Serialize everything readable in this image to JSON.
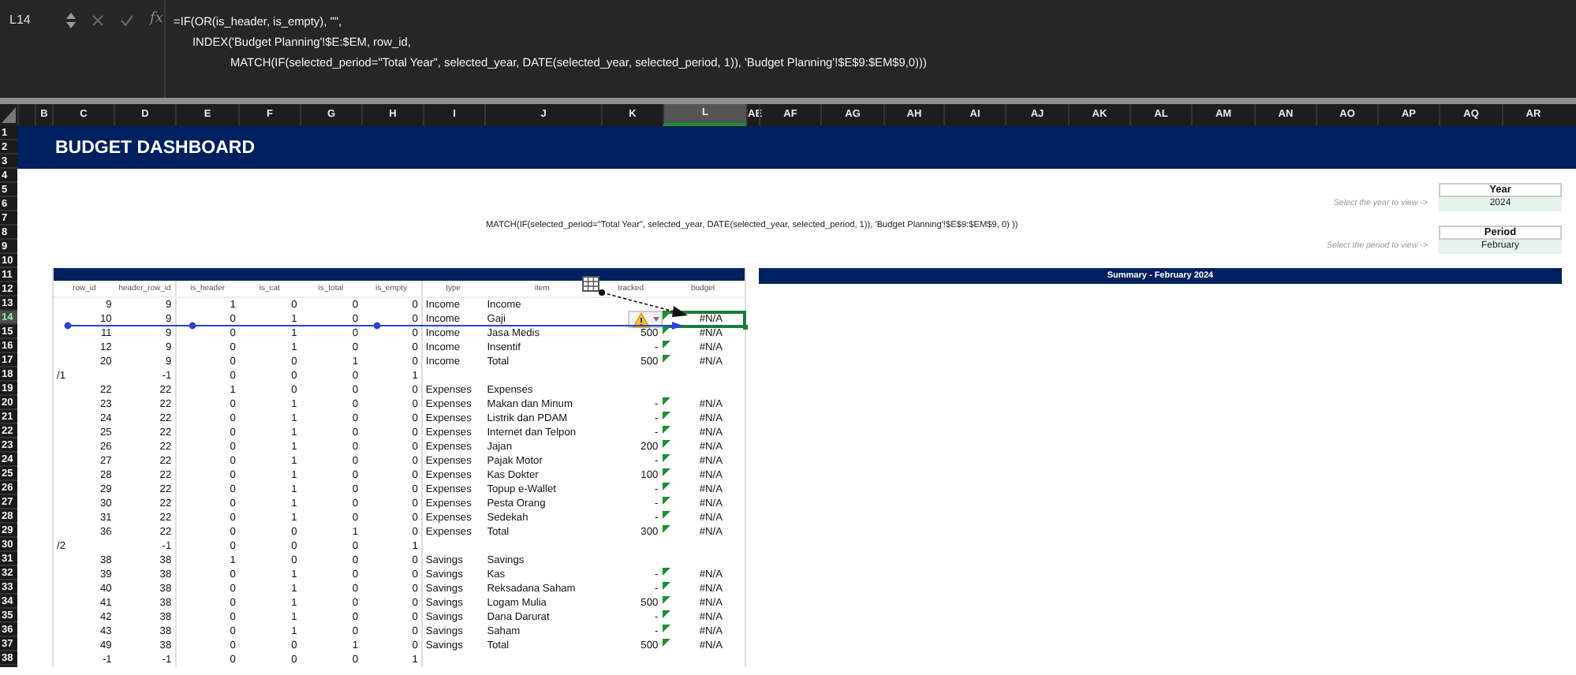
{
  "formula_bar": {
    "cell_ref": "L14",
    "function_label": "fx",
    "lines": [
      {
        "kind": "start",
        "text": "=IF(OR(is_header, is_empty), \"\","
      },
      {
        "kind": "indent",
        "text": "INDEX('Budget Planning'!$E:$EM, row_id,"
      },
      {
        "kind": "deep",
        "text": "MATCH(IF(selected_period=\"Total Year\", selected_year, DATE(selected_year, selected_period, 1)), 'Budget Planning'!$E$9:$EM$9,0)))"
      }
    ]
  },
  "columns": [
    {
      "label": "B",
      "selected": false
    },
    {
      "label": "C",
      "selected": false
    },
    {
      "label": "D",
      "selected": false
    },
    {
      "label": "E",
      "selected": false
    },
    {
      "label": "F",
      "selected": false
    },
    {
      "label": "G",
      "selected": false
    },
    {
      "label": "H",
      "selected": false
    },
    {
      "label": "I",
      "selected": false
    },
    {
      "label": "J",
      "selected": false
    },
    {
      "label": "K",
      "selected": false
    },
    {
      "label": "L",
      "selected": true
    },
    {
      "label": "AE",
      "selected": false
    },
    {
      "label": "AF",
      "selected": false
    },
    {
      "label": "AG",
      "selected": false
    },
    {
      "label": "AH",
      "selected": false
    },
    {
      "label": "AI",
      "selected": false
    },
    {
      "label": "AJ",
      "selected": false
    },
    {
      "label": "AK",
      "selected": false
    },
    {
      "label": "AL",
      "selected": false
    },
    {
      "label": "AM",
      "selected": false
    },
    {
      "label": "AN",
      "selected": false
    },
    {
      "label": "AO",
      "selected": false
    },
    {
      "label": "AP",
      "selected": false
    },
    {
      "label": "AQ",
      "selected": false
    },
    {
      "label": "AR",
      "selected": false
    }
  ],
  "row_numbers": [
    {
      "label": "1",
      "selected": false
    },
    {
      "label": "2",
      "selected": false
    },
    {
      "label": "3",
      "selected": false
    },
    {
      "label": "4",
      "selected": false
    },
    {
      "label": "5",
      "selected": false
    },
    {
      "label": "6",
      "selected": false
    },
    {
      "label": "7",
      "selected": false
    },
    {
      "label": "8",
      "selected": false
    },
    {
      "label": "9",
      "selected": false
    },
    {
      "label": "10",
      "selected": false
    },
    {
      "label": "11",
      "selected": false
    },
    {
      "label": "12",
      "selected": false
    },
    {
      "label": "13",
      "selected": false
    },
    {
      "label": "14",
      "selected": true
    },
    {
      "label": "15",
      "selected": false
    },
    {
      "label": "16",
      "selected": false
    },
    {
      "label": "17",
      "selected": false
    },
    {
      "label": "18",
      "selected": false
    },
    {
      "label": "19",
      "selected": false
    },
    {
      "label": "20",
      "selected": false
    },
    {
      "label": "21",
      "selected": false
    },
    {
      "label": "22",
      "selected": false
    },
    {
      "label": "23",
      "selected": false
    },
    {
      "label": "24",
      "selected": false
    },
    {
      "label": "25",
      "selected": false
    },
    {
      "label": "26",
      "selected": false
    },
    {
      "label": "27",
      "selected": false
    },
    {
      "label": "28",
      "selected": false
    },
    {
      "label": "29",
      "selected": false
    },
    {
      "label": "30",
      "selected": false
    },
    {
      "label": "31",
      "selected": false
    },
    {
      "label": "32",
      "selected": false
    },
    {
      "label": "33",
      "selected": false
    },
    {
      "label": "34",
      "selected": false
    },
    {
      "label": "35",
      "selected": false
    },
    {
      "label": "36",
      "selected": false
    },
    {
      "label": "37",
      "selected": false
    },
    {
      "label": "38",
      "selected": false
    }
  ],
  "title": "BUDGET DASHBOARD",
  "formula_note": "MATCH(IF(selected_period=\"Total Year\", selected_year, DATE(selected_year, selected_period, 1)), 'Budget Planning'!$E$9:$EM$9, 0) ))",
  "year": {
    "label": "Year",
    "hint": "Select the year to view ->",
    "value": "2024"
  },
  "period": {
    "label": "Period",
    "hint": "Select the period to view ->",
    "value": "February"
  },
  "summary_title": "Summary - February 2024",
  "table": {
    "columns": [
      "row_id",
      "header_row_id",
      "is_header",
      "is_cat",
      "is_total",
      "is_empty",
      "type",
      "item",
      "tracked",
      "budget"
    ],
    "rows": [
      {
        "kind": "data",
        "row_id": "9",
        "header_row_id": "9",
        "is_header": "1",
        "is_cat": "0",
        "is_total": "0",
        "is_empty": "0",
        "type": "Income",
        "item": "Income",
        "flagged": false,
        "traced": false,
        "selected": false
      },
      {
        "kind": "data",
        "row_id": "10",
        "header_row_id": "9",
        "is_header": "0",
        "is_cat": "1",
        "is_total": "0",
        "is_empty": "0",
        "type": "Income",
        "item": "Gaji",
        "budget": "#N/A",
        "flagged": true,
        "traced": true,
        "selected": true
      },
      {
        "kind": "data",
        "row_id": "11",
        "header_row_id": "9",
        "is_header": "0",
        "is_cat": "1",
        "is_total": "0",
        "is_empty": "0",
        "type": "Income",
        "item": "Jasa Medis",
        "tracked": "500",
        "budget": "#N/A",
        "flagged": true,
        "traced": false,
        "selected": false
      },
      {
        "kind": "data",
        "row_id": "12",
        "header_row_id": "9",
        "is_header": "0",
        "is_cat": "1",
        "is_total": "0",
        "is_empty": "0",
        "type": "Income",
        "item": "Insentif",
        "tracked": "-",
        "budget": "#N/A",
        "flagged": true,
        "traced": false,
        "selected": false
      },
      {
        "kind": "data",
        "row_id": "20",
        "header_row_id": "9",
        "is_header": "0",
        "is_cat": "0",
        "is_total": "1",
        "is_empty": "0",
        "type": "Income",
        "item": "Total",
        "tracked": "500",
        "budget": "#N/A",
        "flagged": true,
        "traced": false,
        "selected": false
      },
      {
        "kind": "separator",
        "row_id": "/1",
        "header_row_id": "-1",
        "is_header": "0",
        "is_cat": "0",
        "is_total": "0",
        "is_empty": "1",
        "flagged": false,
        "traced": false,
        "selected": false
      },
      {
        "kind": "data",
        "row_id": "22",
        "header_row_id": "22",
        "is_header": "1",
        "is_cat": "0",
        "is_total": "0",
        "is_empty": "0",
        "type": "Expenses",
        "item": "Expenses",
        "flagged": false,
        "traced": false,
        "selected": false
      },
      {
        "kind": "data",
        "row_id": "23",
        "header_row_id": "22",
        "is_header": "0",
        "is_cat": "1",
        "is_total": "0",
        "is_empty": "0",
        "type": "Expenses",
        "item": "Makan dan Minum",
        "tracked": "-",
        "budget": "#N/A",
        "flagged": true,
        "traced": false,
        "selected": false
      },
      {
        "kind": "data",
        "row_id": "24",
        "header_row_id": "22",
        "is_header": "0",
        "is_cat": "1",
        "is_total": "0",
        "is_empty": "0",
        "type": "Expenses",
        "item": "Listrik dan PDAM",
        "tracked": "-",
        "budget": "#N/A",
        "flagged": true,
        "traced": false,
        "selected": false
      },
      {
        "kind": "data",
        "row_id": "25",
        "header_row_id": "22",
        "is_header": "0",
        "is_cat": "1",
        "is_total": "0",
        "is_empty": "0",
        "type": "Expenses",
        "item": "Internet dan Telpon",
        "tracked": "-",
        "budget": "#N/A",
        "flagged": true,
        "traced": false,
        "selected": false
      },
      {
        "kind": "data",
        "row_id": "26",
        "header_row_id": "22",
        "is_header": "0",
        "is_cat": "1",
        "is_total": "0",
        "is_empty": "0",
        "type": "Expenses",
        "item": "Jajan",
        "tracked": "200",
        "budget": "#N/A",
        "flagged": true,
        "traced": false,
        "selected": false
      },
      {
        "kind": "data",
        "row_id": "27",
        "header_row_id": "22",
        "is_header": "0",
        "is_cat": "1",
        "is_total": "0",
        "is_empty": "0",
        "type": "Expenses",
        "item": "Pajak Motor",
        "tracked": "-",
        "budget": "#N/A",
        "flagged": true,
        "traced": false,
        "selected": false
      },
      {
        "kind": "data",
        "row_id": "28",
        "header_row_id": "22",
        "is_header": "0",
        "is_cat": "1",
        "is_total": "0",
        "is_empty": "0",
        "type": "Expenses",
        "item": "Kas Dokter",
        "tracked": "100",
        "budget": "#N/A",
        "flagged": true,
        "traced": false,
        "selected": false
      },
      {
        "kind": "data",
        "row_id": "29",
        "header_row_id": "22",
        "is_header": "0",
        "is_cat": "1",
        "is_total": "0",
        "is_empty": "0",
        "type": "Expenses",
        "item": "Topup e-Wallet",
        "tracked": "-",
        "budget": "#N/A",
        "flagged": true,
        "traced": false,
        "selected": false
      },
      {
        "kind": "data",
        "row_id": "30",
        "header_row_id": "22",
        "is_header": "0",
        "is_cat": "1",
        "is_total": "0",
        "is_empty": "0",
        "type": "Expenses",
        "item": "Pesta Orang",
        "tracked": "-",
        "budget": "#N/A",
        "flagged": true,
        "traced": false,
        "selected": false
      },
      {
        "kind": "data",
        "row_id": "31",
        "header_row_id": "22",
        "is_header": "0",
        "is_cat": "1",
        "is_total": "0",
        "is_empty": "0",
        "type": "Expenses",
        "item": "Sedekah",
        "tracked": "-",
        "budget": "#N/A",
        "flagged": true,
        "traced": false,
        "selected": false
      },
      {
        "kind": "data",
        "row_id": "36",
        "header_row_id": "22",
        "is_header": "0",
        "is_cat": "0",
        "is_total": "1",
        "is_empty": "0",
        "type": "Expenses",
        "item": "Total",
        "tracked": "300",
        "budget": "#N/A",
        "flagged": true,
        "traced": false,
        "selected": false
      },
      {
        "kind": "separator",
        "row_id": "/2",
        "header_row_id": "-1",
        "is_header": "0",
        "is_cat": "0",
        "is_total": "0",
        "is_empty": "1",
        "flagged": false,
        "traced": false,
        "selected": false
      },
      {
        "kind": "data",
        "row_id": "38",
        "header_row_id": "38",
        "is_header": "1",
        "is_cat": "0",
        "is_total": "0",
        "is_empty": "0",
        "type": "Savings",
        "item": "Savings",
        "flagged": false,
        "traced": false,
        "selected": false
      },
      {
        "kind": "data",
        "row_id": "39",
        "header_row_id": "38",
        "is_header": "0",
        "is_cat": "1",
        "is_total": "0",
        "is_empty": "0",
        "type": "Savings",
        "item": "Kas",
        "tracked": "-",
        "budget": "#N/A",
        "flagged": true,
        "traced": false,
        "selected": false
      },
      {
        "kind": "data",
        "row_id": "40",
        "header_row_id": "38",
        "is_header": "0",
        "is_cat": "1",
        "is_total": "0",
        "is_empty": "0",
        "type": "Savings",
        "item": "Reksadana Saham",
        "tracked": "-",
        "budget": "#N/A",
        "flagged": true,
        "traced": false,
        "selected": false
      },
      {
        "kind": "data",
        "row_id": "41",
        "header_row_id": "38",
        "is_header": "0",
        "is_cat": "1",
        "is_total": "0",
        "is_empty": "0",
        "type": "Savings",
        "item": "Logam Mulia",
        "tracked": "500",
        "budget": "#N/A",
        "flagged": true,
        "traced": false,
        "selected": false
      },
      {
        "kind": "data",
        "row_id": "42",
        "header_row_id": "38",
        "is_header": "0",
        "is_cat": "1",
        "is_total": "0",
        "is_empty": "0",
        "type": "Savings",
        "item": "Dana Darurat",
        "tracked": "-",
        "budget": "#N/A",
        "flagged": true,
        "traced": false,
        "selected": false
      },
      {
        "kind": "data",
        "row_id": "43",
        "header_row_id": "38",
        "is_header": "0",
        "is_cat": "1",
        "is_total": "0",
        "is_empty": "0",
        "type": "Savings",
        "item": "Saham",
        "tracked": "-",
        "budget": "#N/A",
        "flagged": true,
        "traced": false,
        "selected": false
      },
      {
        "kind": "data",
        "row_id": "49",
        "header_row_id": "38",
        "is_header": "0",
        "is_cat": "0",
        "is_total": "1",
        "is_empty": "0",
        "type": "Savings",
        "item": "Total",
        "tracked": "500",
        "budget": "#N/A",
        "flagged": true,
        "traced": false,
        "selected": false
      },
      {
        "kind": "data",
        "row_id": "-1",
        "header_row_id": "-1",
        "is_header": "0",
        "is_cat": "0",
        "is_total": "0",
        "is_empty": "1",
        "flagged": false,
        "traced": false,
        "selected": false
      }
    ]
  }
}
